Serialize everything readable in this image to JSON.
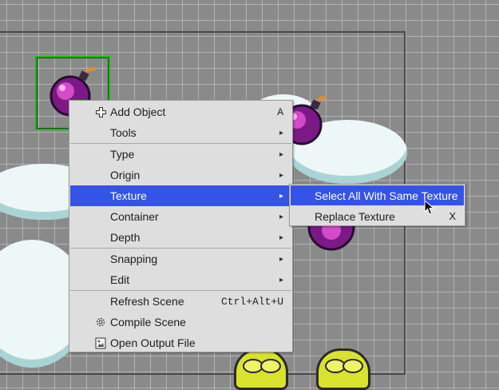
{
  "context_menu": {
    "items": [
      {
        "label": "Add Object",
        "shortcut": "A",
        "icon": "plus-icon"
      },
      {
        "label": "Tools",
        "submenu_arrow": "▸"
      },
      {
        "label": "Type",
        "submenu_arrow": "▸"
      },
      {
        "label": "Origin",
        "submenu_arrow": "▸"
      },
      {
        "label": "Texture",
        "submenu_arrow": "▸",
        "highlighted": true
      },
      {
        "label": "Container",
        "submenu_arrow": "▸"
      },
      {
        "label": "Depth",
        "submenu_arrow": "▸"
      },
      {
        "label": "Snapping",
        "submenu_arrow": "▸"
      },
      {
        "label": "Edit",
        "submenu_arrow": "▸"
      },
      {
        "label": "Refresh Scene",
        "shortcut": "Ctrl+Alt+U"
      },
      {
        "label": "Compile Scene",
        "icon": "gear-icon"
      },
      {
        "label": "Open Output File",
        "icon": "file-image-icon"
      }
    ]
  },
  "texture_submenu": {
    "items": [
      {
        "label": "Select All With Same Texture",
        "highlighted": true
      },
      {
        "label": "Replace Texture",
        "shortcut": "X"
      }
    ]
  },
  "colors": {
    "highlight": "#3553e6",
    "menu_bg": "#dedede",
    "selection_box": "#18b818",
    "canvas_bg": "#8a8a8a"
  }
}
